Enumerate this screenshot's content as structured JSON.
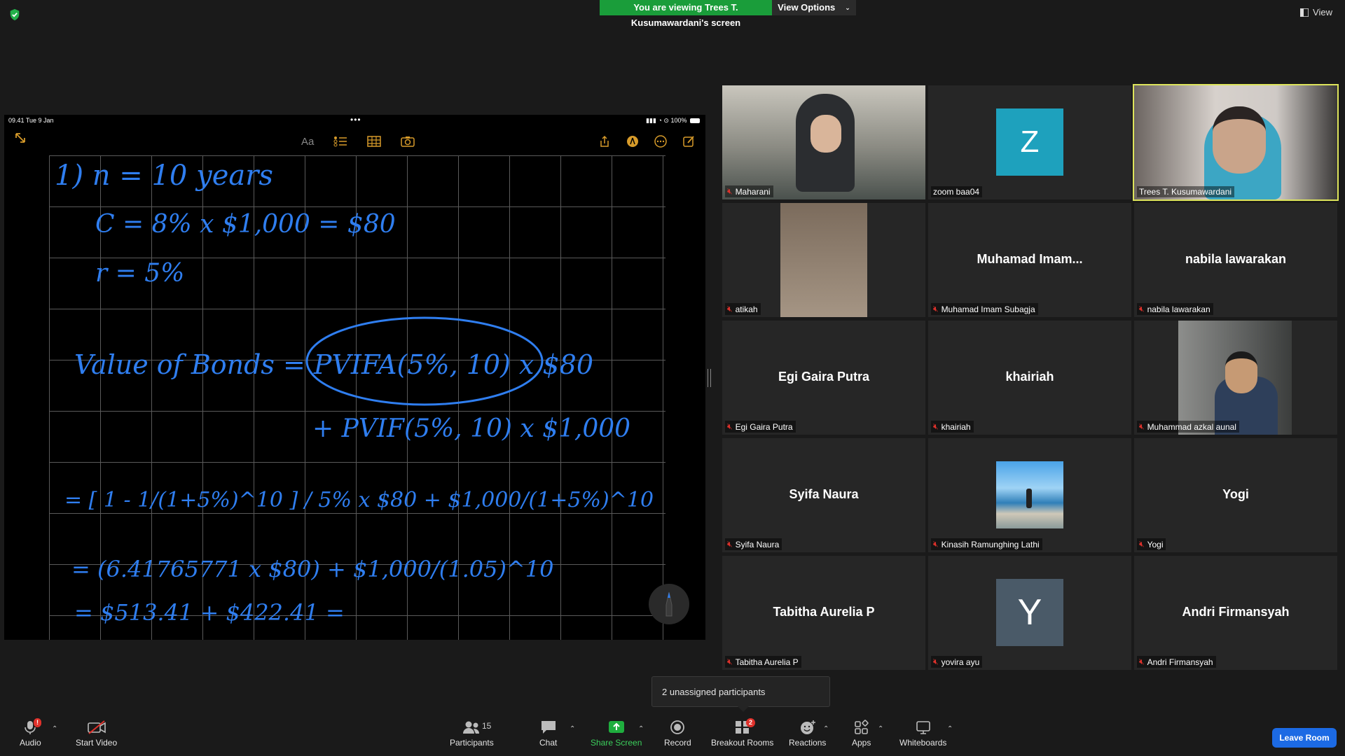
{
  "banner": {
    "message": "You are viewing Trees T. Kusumawardani's screen",
    "view_options": "View Options"
  },
  "view_button": "View",
  "shared_screen": {
    "status_time": "09.41  Tue 9 Jan",
    "status_dots": "•••",
    "status_battery": "100%",
    "toolbar_text": "Aa",
    "note_lines": [
      "1)  n = 10 years",
      "C = 8% x $1,000 = $80",
      "r = 5%",
      "Value of Bonds = PVIFA(5%, 10) x $80",
      "+ PVIF(5%, 10) x $1,000",
      "= [ 1 - 1/(1+5%)^10 ] / 5% x $80 + $1,000/(1+5%)^10",
      "= (6.41765771 x $80) + $1,000/(1.05)^10",
      "= $513.41 + $422.41 ="
    ]
  },
  "participants_grid": [
    {
      "name": "Maharani",
      "big": "",
      "avatar": "",
      "video": true
    },
    {
      "name": "zoom baa04",
      "big": "",
      "avatar": "Z",
      "avatar_color": "#1ea1bd"
    },
    {
      "name": "Trees T. Kusumawardani",
      "big": "",
      "avatar": "",
      "video": true,
      "active": true
    },
    {
      "name": "atikah",
      "big": "",
      "avatar": "",
      "video": true
    },
    {
      "name": "Muhamad Imam Subagja",
      "big": "Muhamad  Imam..."
    },
    {
      "name": "nabila lawarakan",
      "big": "nabila lawarakan"
    },
    {
      "name": "Egi Gaira Putra",
      "big": "Egi Gaira Putra"
    },
    {
      "name": "khairiah",
      "big": "khairiah"
    },
    {
      "name": "Muhammad azkal aunal",
      "big": "",
      "video": true
    },
    {
      "name": "Syifa Naura",
      "big": "Syifa Naura"
    },
    {
      "name": "Kinasih Ramunghing Lathi",
      "big": "",
      "video": true
    },
    {
      "name": "Yogi",
      "big": "Yogi"
    },
    {
      "name": "Tabitha Aurelia P",
      "big": "Tabitha Aurelia P"
    },
    {
      "name": "yovira ayu",
      "big": "",
      "avatar": "Y",
      "avatar_color": "#4a5a68"
    },
    {
      "name": "Andri Firmansyah",
      "big": "Andri Firmansyah"
    }
  ],
  "tooltip": "2 unassigned participants",
  "toolbar": {
    "audio": "Audio",
    "audio_badge": "!",
    "start_video": "Start Video",
    "participants": "Participants",
    "participants_count": "15",
    "chat": "Chat",
    "share_screen": "Share Screen",
    "record": "Record",
    "breakout": "Breakout Rooms",
    "breakout_badge": "2",
    "reactions": "Reactions",
    "apps": "Apps",
    "whiteboards": "Whiteboards",
    "leave": "Leave Room"
  },
  "colors": {
    "accent_green": "#1a9d3a",
    "leave_blue": "#1c6ae4",
    "ink_blue": "#2f7ef0",
    "active_border": "#dde45b"
  }
}
